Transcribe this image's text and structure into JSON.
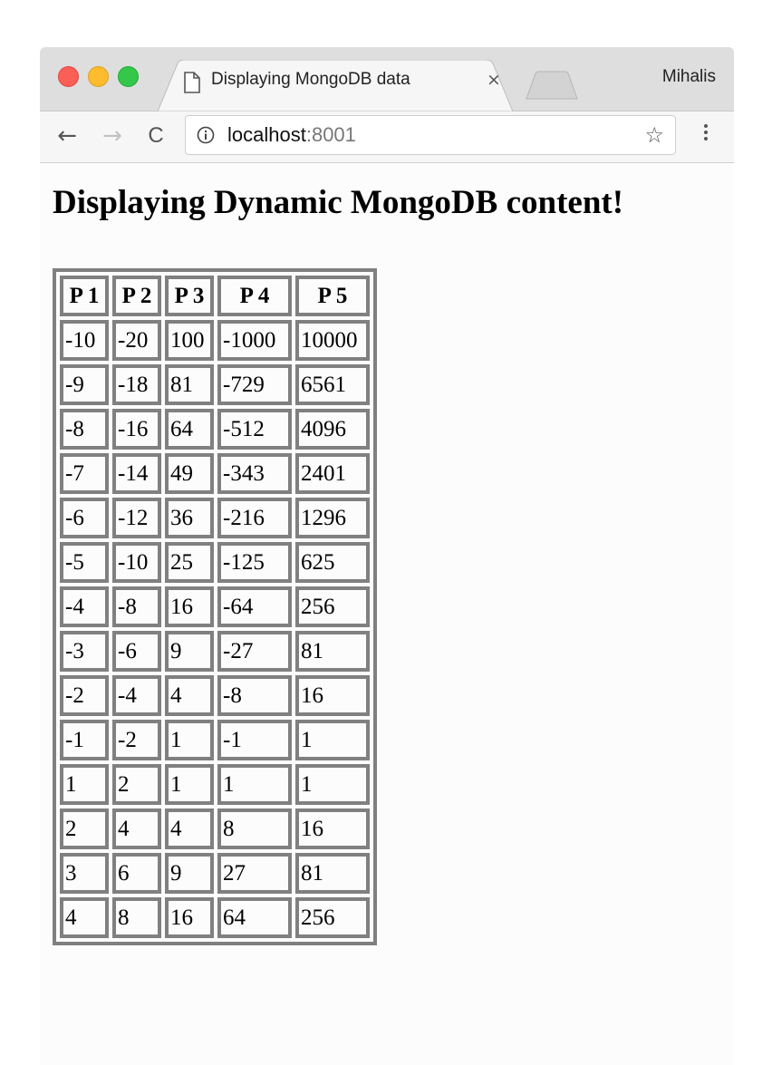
{
  "browser": {
    "tab": {
      "title": "Displaying MongoDB data",
      "close_glyph": "×",
      "icon": "document-icon"
    },
    "profile_name": "Mihalis",
    "address": {
      "host": "localhost",
      "port": ":8001"
    },
    "nav": {
      "back_glyph": "←",
      "forward_glyph": "→",
      "reload_glyph": "C"
    },
    "bookmark_glyph": "☆"
  },
  "page": {
    "title": "Displaying Dynamic MongoDB content!",
    "table": {
      "headers": [
        "P 1",
        "P 2",
        "P 3",
        "P 4",
        "P 5"
      ],
      "rows": [
        [
          "-10",
          "-20",
          "100",
          "-1000",
          "10000"
        ],
        [
          "-9",
          "-18",
          "81",
          "-729",
          "6561"
        ],
        [
          "-8",
          "-16",
          "64",
          "-512",
          "4096"
        ],
        [
          "-7",
          "-14",
          "49",
          "-343",
          "2401"
        ],
        [
          "-6",
          "-12",
          "36",
          "-216",
          "1296"
        ],
        [
          "-5",
          "-10",
          "25",
          "-125",
          "625"
        ],
        [
          "-4",
          "-8",
          "16",
          "-64",
          "256"
        ],
        [
          "-3",
          "-6",
          "9",
          "-27",
          "81"
        ],
        [
          "-2",
          "-4",
          "4",
          "-8",
          "16"
        ],
        [
          "-1",
          "-2",
          "1",
          "-1",
          "1"
        ],
        [
          "1",
          "2",
          "1",
          "1",
          "1"
        ],
        [
          "2",
          "4",
          "4",
          "8",
          "16"
        ],
        [
          "3",
          "6",
          "9",
          "27",
          "81"
        ],
        [
          "4",
          "8",
          "16",
          "64",
          "256"
        ]
      ]
    }
  },
  "colors": {
    "close_button": "#fc5f57",
    "minimize_button": "#fdbc2e",
    "zoom_button": "#34c84a",
    "table_border": "#808080"
  }
}
